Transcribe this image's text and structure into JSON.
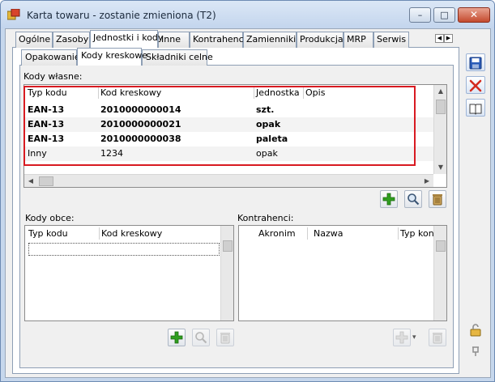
{
  "window": {
    "title": "Karta towaru - zostanie zmieniona (T2)",
    "close_glyph": "✕",
    "max_glyph": "□",
    "min_glyph": "–"
  },
  "tabs": [
    "Ogólne",
    "Zasoby",
    "Jednostki i kody",
    "Inne",
    "Kontrahenci",
    "Zamienniki",
    "Produkcja",
    "MRP",
    "Serwis"
  ],
  "active_tab": "Jednostki i kody",
  "subtabs": [
    "Opakowanie",
    "Kody kreskowe",
    "Składniki celne"
  ],
  "active_subtab": "Kody kreskowe",
  "own_codes": {
    "label": "Kody własne:",
    "columns": [
      "Typ kodu",
      "Kod kreskowy",
      "Jednostka",
      "Opis"
    ],
    "rows": [
      {
        "typ": "EAN-13",
        "kod": "2010000000014",
        "jednostka": "szt.",
        "opis": "",
        "bold": true
      },
      {
        "typ": "EAN-13",
        "kod": "2010000000021",
        "jednostka": "opak",
        "opis": "",
        "bold": true
      },
      {
        "typ": "EAN-13",
        "kod": "2010000000038",
        "jednostka": "paleta",
        "opis": "",
        "bold": true
      },
      {
        "typ": "Inny",
        "kod": "1234",
        "jednostka": "opak",
        "opis": "",
        "bold": false
      }
    ]
  },
  "foreign_codes": {
    "label": "Kody obce:",
    "columns": [
      "Typ kodu",
      "Kod kreskowy"
    ]
  },
  "contractors": {
    "label": "Kontrahenci:",
    "columns": [
      "Akronim",
      "Nazwa",
      "Typ kon"
    ]
  },
  "colors": {
    "highlight": "#d81a21",
    "add": "#2f9e1f",
    "delete": "#d42a1f",
    "save": "#2a5bb8"
  }
}
